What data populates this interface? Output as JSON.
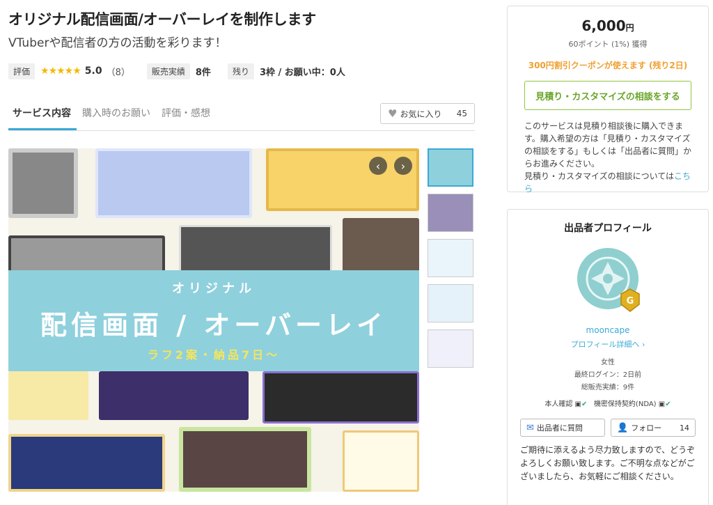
{
  "service": {
    "title": "オリジナル配信画面/オーバーレイを制作します",
    "subtitle": "VTuberや配信者の方の活動を彩ります！",
    "rating_label": "評価",
    "stars": "★★★★★",
    "rating_value": "5.0",
    "rating_count": "（8）",
    "sales_label": "販売実績",
    "sales_value": "8件",
    "remain_label": "残り",
    "remain_value": "3枠 / お願い中：0人"
  },
  "tabs": [
    {
      "label": "サービス内容"
    },
    {
      "label": "購入時のお願い"
    },
    {
      "label": "評価・感想"
    }
  ],
  "favorite": {
    "label": "お気に入り",
    "count": "45"
  },
  "gallery": {
    "banner_sub": "オリジナル",
    "banner_main": "配信画面 / オーバーレイ",
    "banner_note": "ラフ2案・納品7日〜"
  },
  "purchase": {
    "price": "6,000",
    "currency": "円",
    "points": "60ポイント (1%) 獲得",
    "coupon": "300円割引クーポンが使えます (残り2日)",
    "consult_button": "見積り・カスタマイズの相談をする",
    "desc1": "このサービスは見積り相談後に購入できます。購入希望の方は「見積り・カスタマイズの相談をする」もしくは「出品者に質問」からお進みください。",
    "desc2": "見積り・カスタマイズの相談については",
    "desc_link": "こちら"
  },
  "profile": {
    "heading": "出品者プロフィール",
    "username": "mooncape",
    "detail_link": "プロフィール詳細へ",
    "gender": "女性",
    "last_login": "最終ログイン：2日前",
    "total_sales": "総販売実績：9件",
    "identity_label": "本人確認",
    "nda_label": "機密保持契約(NDA)",
    "ask_button": "出品者に質問",
    "follow_button": "フォロー",
    "follow_count": "14",
    "message": "ご期待に添えるよう尽力致しますので、どうぞよろしくお願い致します。ご不明な点などがございましたら、お気軽にご相談ください。"
  },
  "colors": {
    "accent": "#3aa9d6",
    "green": "#8dc63f",
    "coupon": "#f0a030",
    "banner": "#8fd0dd"
  }
}
